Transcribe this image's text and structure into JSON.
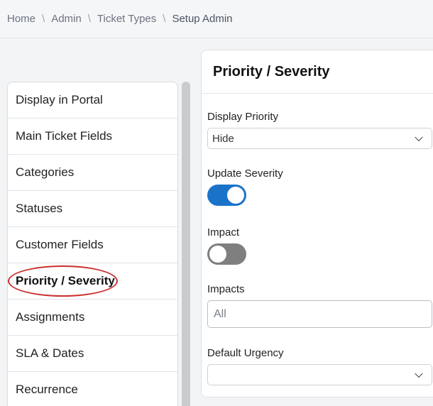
{
  "breadcrumb": {
    "items": [
      "Home",
      "Admin",
      "Ticket Types",
      "Setup Admin"
    ],
    "separator": "\\"
  },
  "nav": {
    "items": [
      {
        "label": "Display in Portal"
      },
      {
        "label": "Main Ticket Fields"
      },
      {
        "label": "Categories"
      },
      {
        "label": "Statuses"
      },
      {
        "label": "Customer Fields"
      },
      {
        "label": "Priority / Severity",
        "active": true
      },
      {
        "label": "Assignments"
      },
      {
        "label": "SLA & Dates"
      },
      {
        "label": "Recurrence"
      }
    ]
  },
  "panel": {
    "title": "Priority / Severity",
    "display_priority": {
      "label": "Display Priority",
      "value": "Hide"
    },
    "update_severity": {
      "label": "Update Severity",
      "on": true
    },
    "impact": {
      "label": "Impact",
      "on": false
    },
    "impacts": {
      "label": "Impacts",
      "placeholder": "All"
    },
    "default_urgency": {
      "label": "Default Urgency",
      "value": ""
    }
  },
  "colors": {
    "toggle_on": "#1a73c9",
    "toggle_off": "#7f7f7f",
    "annotation_circle": "#cc2f2f"
  }
}
